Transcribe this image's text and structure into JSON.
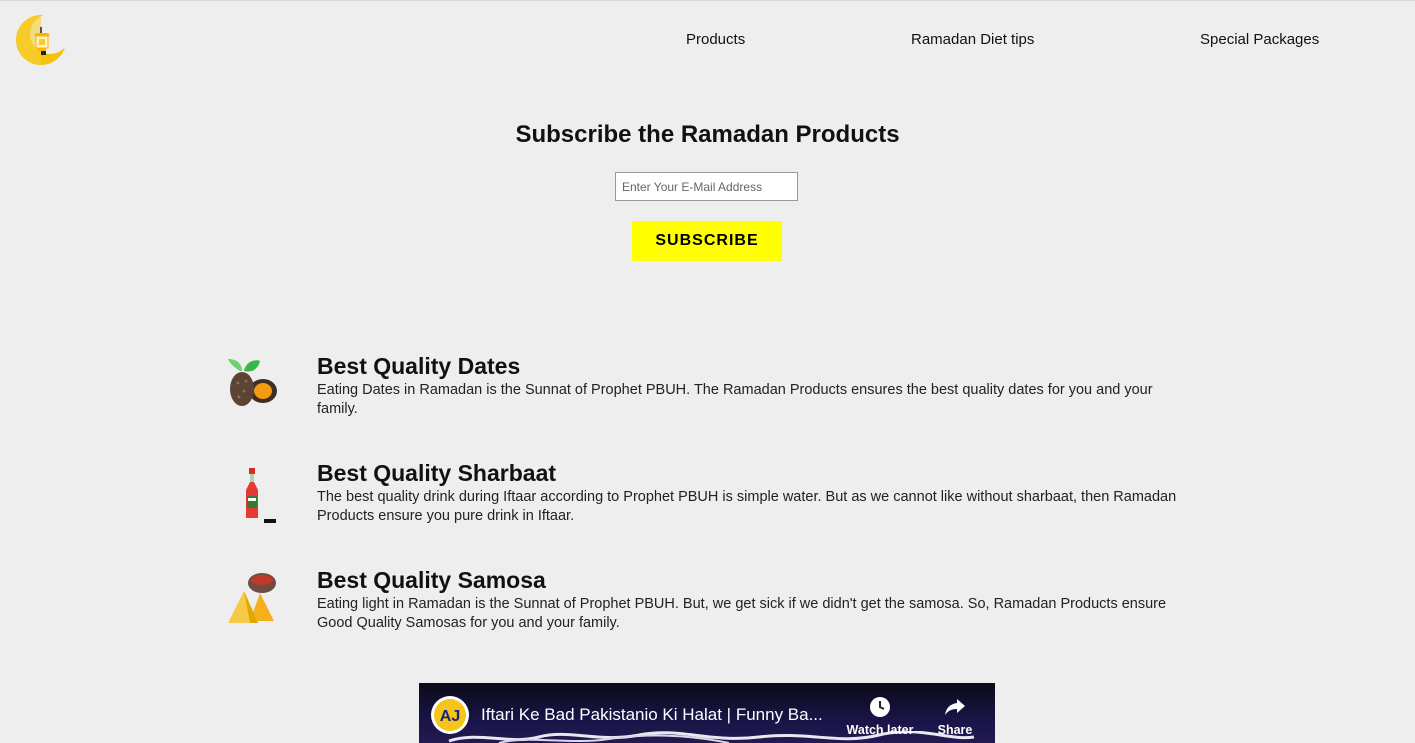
{
  "header": {
    "logo_icon": "crescent-moon-lantern-icon",
    "nav": [
      {
        "label": "Products"
      },
      {
        "label": "Ramadan Diet tips"
      },
      {
        "label": "Special Packages"
      }
    ]
  },
  "subscribe": {
    "title": "Subscribe the Ramadan Products",
    "email_placeholder": "Enter Your E-Mail Address",
    "email_value": "",
    "button_label": "SUBSCRIBE",
    "button_color": "#ffff00"
  },
  "features": [
    {
      "icon": "dates-icon",
      "title": "Best Quality Dates",
      "description": "Eating Dates in Ramadan is the Sunnat of Prophet PBUH. The Ramadan Products ensures the best quality dates for you and your family."
    },
    {
      "icon": "sharbat-bottle-icon",
      "title": "Best Quality Sharbaat",
      "description": "The best quality drink during Iftaar according to Prophet PBUH is simple water. But as we cannot like without sharbaat, then Ramadan Products ensure you pure drink in Iftaar."
    },
    {
      "icon": "samosa-icon",
      "title": "Best Quality Samosa",
      "description": "Eating light in Ramadan is the Sunnat of Prophet PBUH. But, we get sick if we didn't get the samosa. So, Ramadan Products ensure Good Quality Samosas for you and your family."
    }
  ],
  "video": {
    "channel_logo_text": "AJ",
    "title": "Iftari Ke Bad Pakistanio Ki Halat | Funny Ba...",
    "watch_later_label": "Watch later",
    "share_label": "Share"
  },
  "colors": {
    "background": "#eeeeee",
    "accent": "#ffff00"
  }
}
